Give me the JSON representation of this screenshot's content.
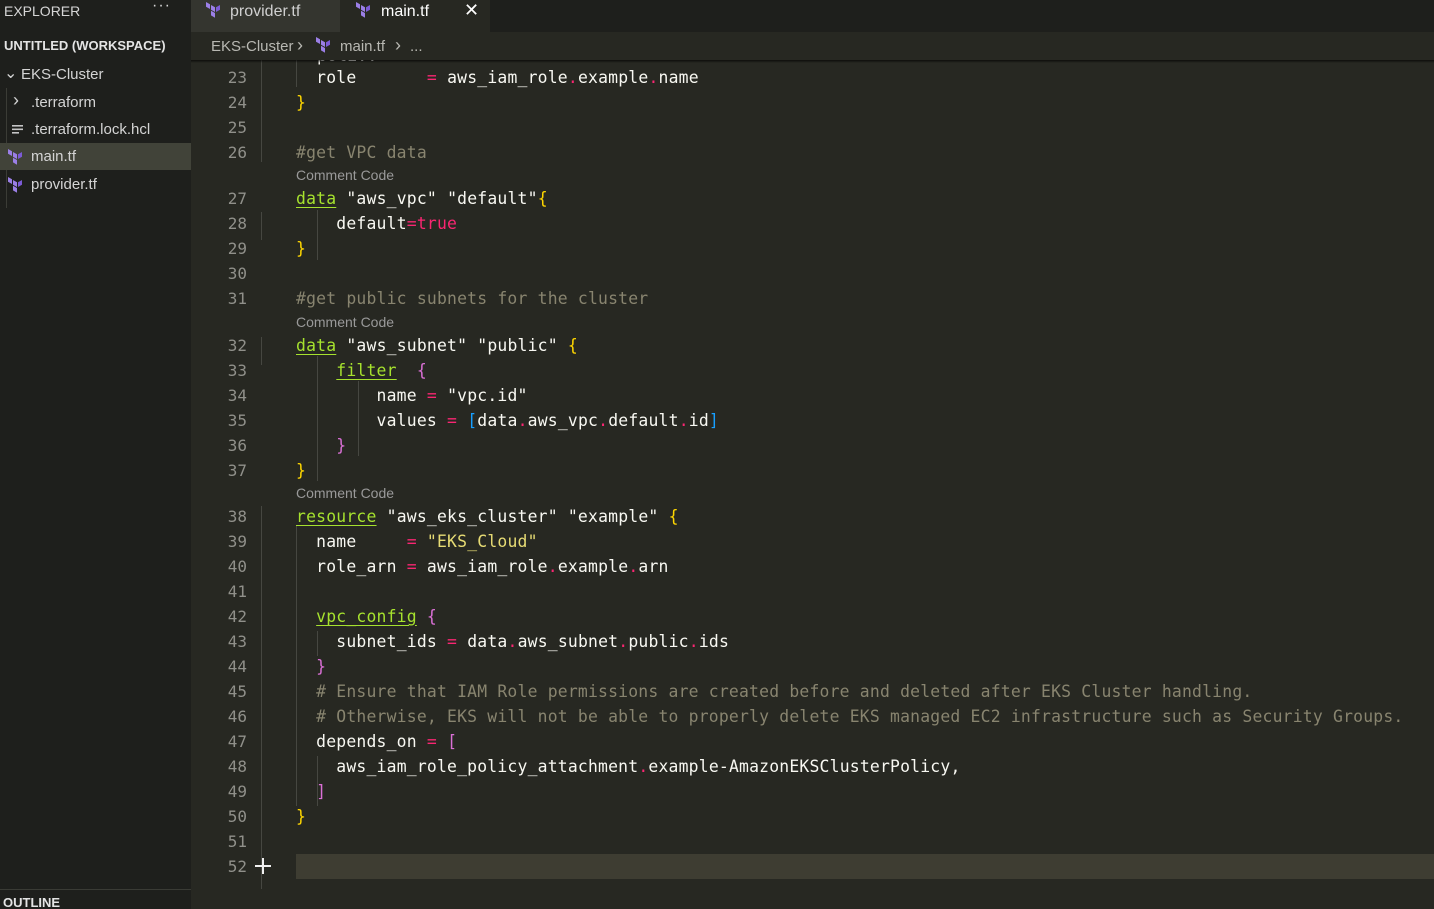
{
  "sidebar": {
    "title": "EXPLORER",
    "more": "···",
    "workspace": "UNTITLED (WORKSPACE)",
    "tree": [
      {
        "label": "EKS-Cluster",
        "chevron": "⌄"
      },
      {
        "label": ".terraform",
        "chevron": "›"
      },
      {
        "label": ".terraform.lock.hcl"
      },
      {
        "label": "main.tf",
        "selected": true
      },
      {
        "label": "provider.tf"
      }
    ],
    "outline": "OUTLINE"
  },
  "tabs": [
    {
      "label": "provider.tf",
      "active": false
    },
    {
      "label": "main.tf",
      "active": true,
      "close": "✕"
    }
  ],
  "breadcrumb": {
    "folder": "EKS-Cluster",
    "sep": "›",
    "file": "main.tf",
    "more": "..."
  },
  "editor": {
    "code_lens_label": "Comment Code",
    "lines": [
      {
        "n": "23",
        "text": "  role       = aws_iam_role.example.name"
      },
      {
        "n": "24",
        "text": "}"
      },
      {
        "n": "25",
        "text": ""
      },
      {
        "n": "26",
        "text": "#get VPC data"
      },
      {
        "n": "27",
        "text": "data \"aws_vpc\" \"default\"{"
      },
      {
        "n": "28",
        "text": "    default=true"
      },
      {
        "n": "29",
        "text": "}"
      },
      {
        "n": "30",
        "text": ""
      },
      {
        "n": "31",
        "text": "#get public subnets for the cluster"
      },
      {
        "n": "32",
        "text": "data \"aws_subnet\" \"public\" {"
      },
      {
        "n": "33",
        "text": "    filter  {"
      },
      {
        "n": "34",
        "text": "        name = \"vpc.id\""
      },
      {
        "n": "35",
        "text": "        values = [data.aws_vpc.default.id]"
      },
      {
        "n": "36",
        "text": "    }"
      },
      {
        "n": "37",
        "text": "}"
      },
      {
        "n": "38",
        "text": "resource \"aws_eks_cluster\" \"example\" {"
      },
      {
        "n": "39",
        "text": "  name     = \"EKS_Cloud\""
      },
      {
        "n": "40",
        "text": "  role_arn = aws_iam_role.example.arn"
      },
      {
        "n": "41",
        "text": ""
      },
      {
        "n": "42",
        "text": "  vpc_config {"
      },
      {
        "n": "43",
        "text": "    subnet_ids = data.aws_subnet.public.ids"
      },
      {
        "n": "44",
        "text": "  }"
      },
      {
        "n": "45",
        "text": "  # Ensure that IAM Role permissions are created before and deleted after EKS Cluster handling."
      },
      {
        "n": "46",
        "text": "  # Otherwise, EKS will not be able to properly delete EKS managed EC2 infrastructure such as Security Groups."
      },
      {
        "n": "47",
        "text": "  depends_on = ["
      },
      {
        "n": "48",
        "text": "    aws_iam_role_policy_attachment.example-AmazonEKSClusterPolicy,"
      },
      {
        "n": "49",
        "text": "  ]"
      },
      {
        "n": "50",
        "text": "}"
      },
      {
        "n": "51",
        "text": ""
      },
      {
        "n": "52",
        "text": "",
        "current": true
      }
    ]
  },
  "colors": {
    "background": "#272822",
    "sidebar": "#1e1f1c",
    "keyword": "#a6e22e",
    "string": "#e6db74",
    "comment": "#88846f",
    "operator": "#f92672",
    "bool": "#ae81ff"
  },
  "icons": {
    "terraform_file": "terraform-logo-icon",
    "lock_file": "lines-file-icon",
    "add_line": "plus-icon"
  }
}
